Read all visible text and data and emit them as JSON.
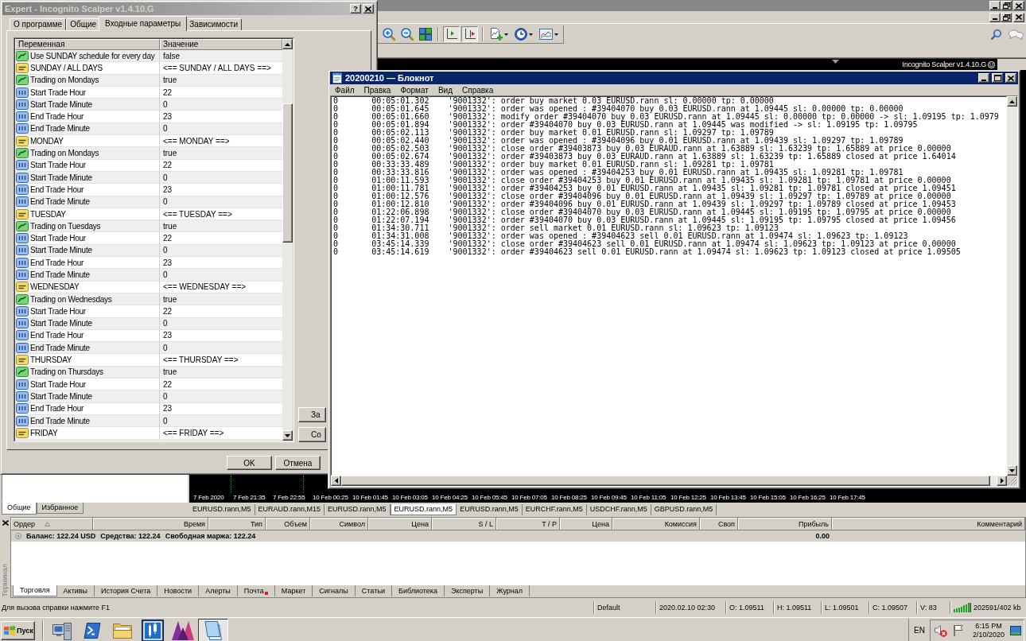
{
  "dialog": {
    "title": "Expert - Incognito Scalper v1.4.10.G",
    "help": "?",
    "tabs": [
      {
        "label": "О программе",
        "selected": false
      },
      {
        "label": "Общие",
        "selected": false
      },
      {
        "label": "Входные параметры",
        "selected": true
      },
      {
        "label": "Зависимости",
        "selected": false
      }
    ],
    "columns": [
      "Переменная",
      "Значение"
    ],
    "rows": [
      {
        "kind": "bool",
        "name": "Use SUNDAY schedule for every day",
        "value": "false"
      },
      {
        "kind": "string",
        "name": "SUNDAY / ALL DAYS",
        "value": "<== SUNDAY / ALL DAYS ==>"
      },
      {
        "kind": "bool",
        "name": "Trading on Mondays",
        "value": "true"
      },
      {
        "kind": "int",
        "name": "Start Trade Hour",
        "value": "22"
      },
      {
        "kind": "int",
        "name": "Start Trade Minute",
        "value": "0"
      },
      {
        "kind": "int",
        "name": "End Trade Hour",
        "value": "23"
      },
      {
        "kind": "int",
        "name": "End Trade Minute",
        "value": "0"
      },
      {
        "kind": "string",
        "name": "MONDAY",
        "value": "<== MONDAY ==>"
      },
      {
        "kind": "bool",
        "name": "Trading on Mondays",
        "value": "true"
      },
      {
        "kind": "int",
        "name": "Start Trade Hour",
        "value": "22"
      },
      {
        "kind": "int",
        "name": "Start Trade Minute",
        "value": "0"
      },
      {
        "kind": "int",
        "name": "End Trade Hour",
        "value": "23"
      },
      {
        "kind": "int",
        "name": "End Trade Minute",
        "value": "0"
      },
      {
        "kind": "string",
        "name": "TUESDAY",
        "value": "<== TUESDAY ==>"
      },
      {
        "kind": "bool",
        "name": "Trading on Tuesdays",
        "value": "true"
      },
      {
        "kind": "int",
        "name": "Start Trade Hour",
        "value": "22"
      },
      {
        "kind": "int",
        "name": "Start Trade Minute",
        "value": "0"
      },
      {
        "kind": "int",
        "name": "End Trade Hour",
        "value": "23"
      },
      {
        "kind": "int",
        "name": "End Trade Minute",
        "value": "0"
      },
      {
        "kind": "string",
        "name": "WEDNESDAY",
        "value": "<== WEDNESDAY ==>"
      },
      {
        "kind": "bool",
        "name": "Trading on Wednesdays",
        "value": "true"
      },
      {
        "kind": "int",
        "name": "Start Trade Hour",
        "value": "22"
      },
      {
        "kind": "int",
        "name": "Start Trade Minute",
        "value": "0"
      },
      {
        "kind": "int",
        "name": "End Trade Hour",
        "value": "23"
      },
      {
        "kind": "int",
        "name": "End Trade Minute",
        "value": "0"
      },
      {
        "kind": "string",
        "name": "THURSDAY",
        "value": "<== THURSDAY ==>"
      },
      {
        "kind": "bool",
        "name": "Trading on Thursdays",
        "value": "true"
      },
      {
        "kind": "int",
        "name": "Start Trade Hour",
        "value": "22"
      },
      {
        "kind": "int",
        "name": "Start Trade Minute",
        "value": "0"
      },
      {
        "kind": "int",
        "name": "End Trade Hour",
        "value": "23"
      },
      {
        "kind": "int",
        "name": "End Trade Minute",
        "value": "0"
      },
      {
        "kind": "string",
        "name": "FRIDAY",
        "value": "<== FRIDAY ==>"
      }
    ],
    "side_buttons": [
      "За",
      "Со"
    ],
    "buttons": [
      "OK",
      "Отмена"
    ]
  },
  "notepad": {
    "title": "20200210 — Блокнот",
    "menu": [
      "Файл",
      "Правка",
      "Формат",
      "Вид",
      "Справка"
    ],
    "lines": [
      "0\t00:05:01.302\t'9001332': order buy market 0.03 EURUSD.rann sl: 0.00000 tp: 0.00000",
      "0\t00:05:01.645\t'9001332': order was opened : #39404070 buy 0.03 EURUSD.rann at 1.09445 sl: 0.00000 tp: 0.00000",
      "0\t00:05:01.660\t'9001332': modify order #39404070 buy 0.03 EURUSD.rann at 1.09445 sl: 0.00000 tp: 0.00000 -> sl: 1.09195 tp: 1.0979",
      "0\t00:05:01.894\t'9001332': order #39404070 buy 0.03 EURUSD.rann at 1.09445 was modified -> sl: 1.09195 tp: 1.09795",
      "0\t00:05:02.113\t'9001332': order buy market 0.01 EURUSD.rann sl: 1.09297 tp: 1.09789",
      "0\t00:05:02.440\t'9001332': order was opened : #39404096 buy 0.01 EURUSD.rann at 1.09439 sl: 1.09297 tp: 1.09789",
      "0\t00:05:02.503\t'9001332': close order #39403873 buy 0.03 EURAUD.rann at 1.63889 sl: 1.63239 tp: 1.65889 at price 0.00000",
      "0\t00:05:02.674\t'9001332': order #39403873 buy 0.03 EURAUD.rann at 1.63889 sl: 1.63239 tp: 1.65889 closed at price 1.64014",
      "0\t00:33:33.489\t'9001332': order buy market 0.01 EURUSD.rann sl: 1.09281 tp: 1.09781",
      "0\t00:33:33.816\t'9001332': order was opened : #39404253 buy 0.01 EURUSD.rann at 1.09435 sl: 1.09281 tp: 1.09781",
      "0\t01:00:11.593\t'9001332': close order #39404253 buy 0.01 EURUSD.rann at 1.09435 sl: 1.09281 tp: 1.09781 at price 0.00000",
      "0\t01:00:11.781\t'9001332': order #39404253 buy 0.01 EURUSD.rann at 1.09435 sl: 1.09281 tp: 1.09781 closed at price 1.09451",
      "0\t01:00:12.576\t'9001332': close order #39404096 buy 0.01 EURUSD.rann at 1.09439 sl: 1.09297 tp: 1.09789 at price 0.00000",
      "0\t01:00:12.810\t'9001332': order #39404096 buy 0.01 EURUSD.rann at 1.09439 sl: 1.09297 tp: 1.09789 closed at price 1.09453",
      "0\t01:22:06.898\t'9001332': close order #39404070 buy 0.03 EURUSD.rann at 1.09445 sl: 1.09195 tp: 1.09795 at price 0.00000",
      "0\t01:22:07.194\t'9001332': order #39404070 buy 0.03 EURUSD.rann at 1.09445 sl: 1.09195 tp: 1.09795 closed at price 1.09456",
      "0\t01:34:30.711\t'9001332': order sell market 0.01 EURUSD.rann sl: 1.09623 tp: 1.09123",
      "0\t01:34:31.008\t'9001332': order was opened : #39404623 sell 0.01 EURUSD.rann at 1.09474 sl: 1.09623 tp: 1.09123",
      "0\t03:45:14.339\t'9001332': close order #39404623 sell 0.01 EURUSD.rann at 1.09474 sl: 1.09623 tp: 1.09123 at price 0.00000",
      "0\t03:45:14.619\t'9001332': order #39404623 sell 0.01 EURUSD.rann at 1.09474 sl: 1.09623 tp: 1.09123 closed at price 1.09505"
    ]
  },
  "main_window": {
    "toolbar": [
      {
        "kind": "zoom_in",
        "pressed": false
      },
      {
        "kind": "zoom_out",
        "pressed": false
      },
      {
        "kind": "tile",
        "pressed": false
      },
      {
        "kind": "chart_shift",
        "pressed": true
      },
      {
        "kind": "autoscroll",
        "pressed": true
      },
      {
        "kind": "indicators",
        "pressed": false
      },
      {
        "kind": "periods",
        "pressed": false
      },
      {
        "kind": "templates",
        "pressed": false
      }
    ],
    "chart": {
      "label": "Incognito Scalper v1.4.10.G",
      "time_axis": [
        "7 Feb 2020",
        "7 Feb 21:35",
        "7 Feb 22:55",
        "10 Feb 00:25",
        "10 Feb 01:45",
        "10 Feb 03:05",
        "10 Feb 04:25",
        "10 Feb 05:45",
        "10 Feb 07:05",
        "10 Feb 08:25",
        "10 Feb 09:45",
        "10 Feb 11:05",
        "10 Feb 12:25",
        "10 Feb 13:45",
        "10 Feb 15:05",
        "10 Feb 16:25",
        "10 Feb 17:45"
      ]
    },
    "navigator_tabs": [
      {
        "label": "Общие",
        "selected": true
      },
      {
        "label": "Избранное",
        "selected": false
      }
    ],
    "chart_tabs": [
      {
        "label": "EURUSD.rann,M5",
        "selected": false
      },
      {
        "label": "EURAUD.rann,M15",
        "selected": false
      },
      {
        "label": "EURUSD.rann,M5",
        "selected": false
      },
      {
        "label": "EURUSD.rann,M5",
        "selected": true
      },
      {
        "label": "EURUSD.rann,M5",
        "selected": false
      },
      {
        "label": "EURCHF.rann,M5",
        "selected": false
      },
      {
        "label": "USDCHF.rann,M5",
        "selected": false
      },
      {
        "label": "GBPUSD.rann,M5",
        "selected": false
      }
    ],
    "terminal": {
      "label": "Терминал",
      "columns": [
        "Ордер",
        "Время",
        "Тип",
        "Объем",
        "Символ",
        "Цена",
        "S / L",
        "T / P",
        "Цена",
        "Комиссия",
        "Своп",
        "Прибыль",
        "Комментарий"
      ],
      "balance": [
        "Баланс: 122.24 USD",
        "Средства: 122.24",
        "Свободная маржа: 122.24"
      ],
      "profit": "0.00",
      "tabs": [
        {
          "label": "Торговля",
          "selected": true,
          "unread": false
        },
        {
          "label": "Активы",
          "selected": false,
          "unread": false
        },
        {
          "label": "История Счета",
          "selected": false,
          "unread": false
        },
        {
          "label": "Новости",
          "selected": false,
          "unread": false
        },
        {
          "label": "Алерты",
          "selected": false,
          "unread": false
        },
        {
          "label": "Почта",
          "selected": false,
          "unread": true
        },
        {
          "label": "Маркет",
          "selected": false,
          "unread": false
        },
        {
          "label": "Сигналы",
          "selected": false,
          "unread": false
        },
        {
          "label": "Статьи",
          "selected": false,
          "unread": false
        },
        {
          "label": "Библиотека",
          "selected": false,
          "unread": false
        },
        {
          "label": "Эксперты",
          "selected": false,
          "unread": false
        },
        {
          "label": "Журнал",
          "selected": false,
          "unread": false
        }
      ]
    },
    "status_bar": {
      "hint": "Для вызова справки нажмите F1",
      "profile": "Default",
      "fields": [
        "2020.02.10 02:30",
        "O: 1.09511",
        "H: 1.09511",
        "L: 1.09501",
        "C: 1.09507",
        "V: 83"
      ],
      "traffic": "202591/402 kb"
    }
  },
  "taskbar": {
    "start": "Пуск",
    "apps": [
      {
        "kind": "server",
        "pressed": false
      },
      {
        "kind": "shell",
        "pressed": false
      },
      {
        "kind": "folder",
        "pressed": false
      },
      {
        "kind": "square_logo",
        "pressed": false
      },
      {
        "kind": "zigzag_logo",
        "pressed": false
      },
      {
        "kind": "notepad",
        "pressed": true
      }
    ],
    "language": "EN",
    "time": "6:15 PM",
    "date": "2/10/2020"
  }
}
